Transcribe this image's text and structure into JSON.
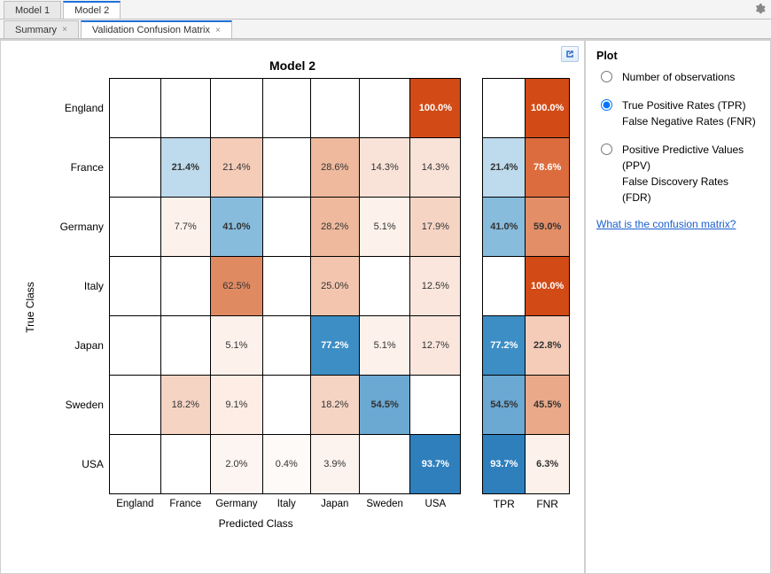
{
  "outer_tabs": [
    {
      "label": "Model 1",
      "active": false,
      "closable": false
    },
    {
      "label": "Model 2",
      "active": true,
      "closable": false
    }
  ],
  "inner_tabs": [
    {
      "label": "Summary",
      "active": false,
      "closable": true
    },
    {
      "label": "Validation Confusion Matrix",
      "active": true,
      "closable": true
    }
  ],
  "chart_data": {
    "type": "heatmap",
    "title": "Model 2",
    "ylabel": "True Class",
    "xlabel": "Predicted Class",
    "row_labels": [
      "England",
      "France",
      "Germany",
      "Italy",
      "Japan",
      "Sweden",
      "USA"
    ],
    "col_labels": [
      "England",
      "France",
      "Germany",
      "Italy",
      "Japan",
      "Sweden",
      "USA"
    ],
    "cells": [
      [
        null,
        null,
        null,
        null,
        null,
        null,
        "100.0%"
      ],
      [
        null,
        "21.4%",
        "21.4%",
        null,
        "28.6%",
        "14.3%",
        "14.3%"
      ],
      [
        null,
        "7.7%",
        "41.0%",
        null,
        "28.2%",
        "5.1%",
        "17.9%"
      ],
      [
        null,
        null,
        "62.5%",
        null,
        "25.0%",
        null,
        "12.5%"
      ],
      [
        null,
        null,
        "5.1%",
        null,
        "77.2%",
        "5.1%",
        "12.7%"
      ],
      [
        null,
        "18.2%",
        "9.1%",
        null,
        "18.2%",
        "54.5%",
        null
      ],
      [
        null,
        null,
        "2.0%",
        "0.4%",
        "3.9%",
        null,
        "93.7%"
      ]
    ],
    "cell_colors": [
      [
        "#ffffff",
        "#ffffff",
        "#ffffff",
        "#ffffff",
        "#ffffff",
        "#ffffff",
        "#d24a16"
      ],
      [
        "#ffffff",
        "#bedaed",
        "#f5ccb8",
        "#ffffff",
        "#efb99d",
        "#f9e3d8",
        "#f9e3d8"
      ],
      [
        "#ffffff",
        "#fdf1eb",
        "#87bcdd",
        "#ffffff",
        "#efb99d",
        "#fdf1eb",
        "#f6d4c4"
      ],
      [
        "#ffffff",
        "#ffffff",
        "#e08a62",
        "#ffffff",
        "#f3c5af",
        "#ffffff",
        "#fae6dc"
      ],
      [
        "#ffffff",
        "#ffffff",
        "#fdf1eb",
        "#ffffff",
        "#3d8ec4",
        "#fdf1eb",
        "#fae6dc"
      ],
      [
        "#ffffff",
        "#f6d4c4",
        "#fdede5",
        "#ffffff",
        "#f6d4c4",
        "#6ba8d2",
        "#ffffff"
      ],
      [
        "#ffffff",
        "#ffffff",
        "#fdf5f1",
        "#fefaf7",
        "#fdf3ee",
        "#ffffff",
        "#2f7fbd"
      ]
    ],
    "cell_text_colors": [
      [
        "",
        "",
        "",
        "",
        "",
        "",
        "#fff"
      ],
      [
        "",
        "#333",
        "#333",
        "",
        "#333",
        "#333",
        "#333"
      ],
      [
        "",
        "#333",
        "#333",
        "",
        "#333",
        "#333",
        "#333"
      ],
      [
        "",
        "",
        "#333",
        "",
        "#333",
        "",
        "#333"
      ],
      [
        "",
        "",
        "#333",
        "",
        "#fff",
        "#333",
        "#333"
      ],
      [
        "",
        "#333",
        "#333",
        "",
        "#333",
        "#333",
        ""
      ],
      [
        "",
        "",
        "#333",
        "#333",
        "#333",
        "",
        "#fff"
      ]
    ],
    "cell_bold": [
      [
        false,
        false,
        false,
        false,
        false,
        false,
        true
      ],
      [
        false,
        true,
        false,
        false,
        false,
        false,
        false
      ],
      [
        false,
        false,
        true,
        false,
        false,
        false,
        false
      ],
      [
        false,
        false,
        false,
        false,
        false,
        false,
        false
      ],
      [
        false,
        false,
        false,
        false,
        true,
        false,
        false
      ],
      [
        false,
        false,
        false,
        false,
        false,
        true,
        false
      ],
      [
        false,
        false,
        false,
        false,
        false,
        false,
        true
      ]
    ],
    "tpr_headers": [
      "TPR",
      "FNR"
    ],
    "tpr_cells": [
      [
        "",
        "100.0%"
      ],
      [
        "21.4%",
        "78.6%"
      ],
      [
        "41.0%",
        "59.0%"
      ],
      [
        "",
        "100.0%"
      ],
      [
        "77.2%",
        "22.8%"
      ],
      [
        "54.5%",
        "45.5%"
      ],
      [
        "93.7%",
        "6.3%"
      ]
    ],
    "tpr_colors": [
      [
        "#ffffff",
        "#d24a16"
      ],
      [
        "#bedaed",
        "#dc6c3e"
      ],
      [
        "#87bcdd",
        "#e38e67"
      ],
      [
        "#ffffff",
        "#d24a16"
      ],
      [
        "#3d8ec4",
        "#f5ccb8"
      ],
      [
        "#6ba8d2",
        "#eaa989"
      ],
      [
        "#2f7fbd",
        "#fdf1eb"
      ]
    ],
    "tpr_text_colors": [
      [
        "",
        "#fff"
      ],
      [
        "#333",
        "#fff"
      ],
      [
        "#333",
        "#333"
      ],
      [
        "",
        "#fff"
      ],
      [
        "#fff",
        "#333"
      ],
      [
        "#333",
        "#333"
      ],
      [
        "#fff",
        "#333"
      ]
    ]
  },
  "side_panel": {
    "heading": "Plot",
    "options": [
      {
        "lines": [
          "Number of observations"
        ],
        "selected": false
      },
      {
        "lines": [
          "True Positive Rates (TPR)",
          "False Negative Rates (FNR)"
        ],
        "selected": true
      },
      {
        "lines": [
          "Positive Predictive Values (PPV)",
          "False Discovery Rates (FDR)"
        ],
        "selected": false
      }
    ],
    "link_text": "What is the confusion matrix?"
  },
  "icons": {
    "gear": "gear-icon",
    "popout": "popout-icon",
    "close": "×"
  }
}
